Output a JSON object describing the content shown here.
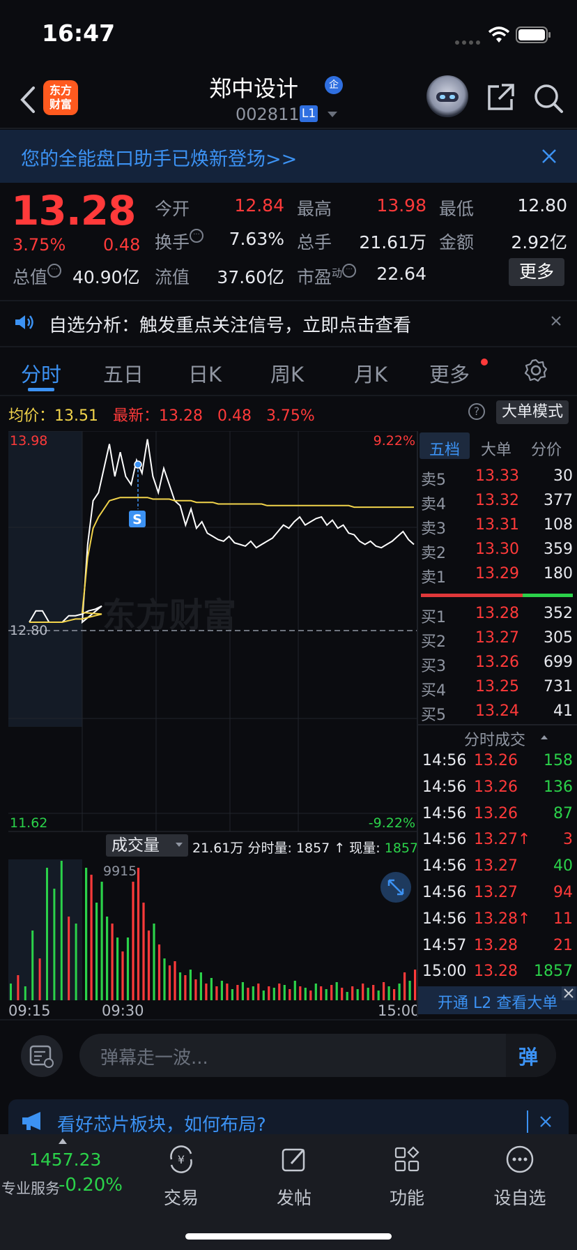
{
  "status_bar": {
    "time": "16:47"
  },
  "header": {
    "logo_text": "东方财富",
    "stock_name": "郑中设计",
    "badge": "企",
    "stock_code": "002811",
    "level": "L1"
  },
  "banner": {
    "text": "您的全能盘口助手已焕新登场>>"
  },
  "quote": {
    "price": "13.28",
    "change_pct": "3.75%",
    "change": "0.48",
    "market_cap_label": "总值",
    "market_cap": "40.90亿",
    "fields": [
      {
        "label": "今开",
        "value": "12.84",
        "color": "red"
      },
      {
        "label": "最高",
        "value": "13.98",
        "color": "red"
      },
      {
        "label": "最低",
        "value": "12.80",
        "color": "white"
      },
      {
        "label": "换手",
        "value": "7.63%",
        "color": "white"
      },
      {
        "label": "总手",
        "value": "21.61万",
        "color": "white"
      },
      {
        "label": "金额",
        "value": "2.92亿",
        "color": "white"
      },
      {
        "label": "流值",
        "value": "37.60亿",
        "color": "white"
      },
      {
        "label": "市盈",
        "sup": "动",
        "value": "22.64",
        "color": "white"
      }
    ],
    "more_button": "更多"
  },
  "notice": {
    "text": "自选分析：触发重点关注信号，立即点击查看"
  },
  "tabs": [
    "分时",
    "五日",
    "日K",
    "周K",
    "月K",
    "更多"
  ],
  "avg_row": {
    "avg_label": "均价：",
    "avg_value": "13.51",
    "latest_label": "最新：",
    "latest_price": "13.28",
    "latest_change": "0.48",
    "latest_pct": "3.75%",
    "big_order_mode": "大单模式"
  },
  "chart_data": {
    "type": "line",
    "y_high_label": "13.98",
    "y_mid_label": "12.80",
    "y_low_label": "11.62",
    "pct_high_label": "9.22%",
    "pct_low_label": "-9.22%",
    "ylim": [
      11.62,
      13.98
    ],
    "prev_close": 12.8,
    "x_labels": [
      "09:15",
      "09:30",
      "15:00"
    ],
    "watermark": "东方财富",
    "signal_marker": "S",
    "price_series": [
      12.8,
      12.87,
      12.87,
      12.8,
      12.8,
      12.8,
      12.84,
      12.84,
      12.85,
      12.87,
      12.88,
      12.9,
      12.8,
      13.28,
      13.55,
      13.6,
      13.75,
      13.9,
      13.7,
      13.85,
      13.7,
      13.65,
      13.8,
      13.72,
      13.93,
      13.7,
      13.6,
      13.75,
      13.65,
      13.55,
      13.52,
      13.4,
      13.5,
      13.38,
      13.42,
      13.35,
      13.33,
      13.31,
      13.3,
      13.33,
      13.29,
      13.28,
      13.27,
      13.3,
      13.26,
      13.28,
      13.3,
      13.32,
      13.36,
      13.4,
      13.38,
      13.42,
      13.45,
      13.4,
      13.42,
      13.44,
      13.45,
      13.4,
      13.43,
      13.38,
      13.4,
      13.35,
      13.34,
      13.3,
      13.28,
      13.3,
      13.27,
      13.26,
      13.28,
      13.3,
      13.33,
      13.36,
      13.31,
      13.28
    ],
    "avg_series": [
      12.8,
      12.8,
      12.8,
      12.8,
      12.8,
      12.8,
      12.81,
      12.82,
      12.82,
      12.83,
      12.84,
      12.85,
      12.86,
      13.2,
      13.38,
      13.45,
      13.5,
      13.55,
      13.56,
      13.57,
      13.57,
      13.57,
      13.57,
      13.57,
      13.57,
      13.56,
      13.56,
      13.56,
      13.56,
      13.55,
      13.55,
      13.55,
      13.55,
      13.54,
      13.54,
      13.54,
      13.54,
      13.53,
      13.53,
      13.53,
      13.53,
      13.53,
      13.53,
      13.53,
      13.53,
      13.53,
      13.52,
      13.52,
      13.52,
      13.52,
      13.52,
      13.52,
      13.52,
      13.52,
      13.52,
      13.52,
      13.52,
      13.52,
      13.52,
      13.52,
      13.52,
      13.52,
      13.51,
      13.51,
      13.51,
      13.51,
      13.51,
      13.51,
      13.51,
      13.51,
      13.51,
      13.51,
      13.51,
      13.51
    ],
    "volume_max_label": "9915",
    "volumes": [
      {
        "v": 0.12,
        "c": "g"
      },
      {
        "v": 0.18,
        "c": "r"
      },
      {
        "v": 0.1,
        "c": "g"
      },
      {
        "v": 0.5,
        "c": "g"
      },
      {
        "v": 0.3,
        "c": "r"
      },
      {
        "v": 0.95,
        "c": "g"
      },
      {
        "v": 0.8,
        "c": "g"
      },
      {
        "v": 1.0,
        "c": "g"
      },
      {
        "v": 0.6,
        "c": "r"
      },
      {
        "v": 0.55,
        "c": "g"
      },
      {
        "v": 0.95,
        "c": "g"
      },
      {
        "v": 0.9,
        "c": "r"
      },
      {
        "v": 0.7,
        "c": "g"
      },
      {
        "v": 0.85,
        "c": "g"
      },
      {
        "v": 0.6,
        "c": "g"
      },
      {
        "v": 0.55,
        "c": "r"
      },
      {
        "v": 0.45,
        "c": "g"
      },
      {
        "v": 0.35,
        "c": "r"
      },
      {
        "v": 0.45,
        "c": "g"
      },
      {
        "v": 0.85,
        "c": "r"
      },
      {
        "v": 0.95,
        "c": "r"
      },
      {
        "v": 0.7,
        "c": "r"
      },
      {
        "v": 0.5,
        "c": "r"
      },
      {
        "v": 0.55,
        "c": "g"
      },
      {
        "v": 0.4,
        "c": "r"
      },
      {
        "v": 0.3,
        "c": "g"
      },
      {
        "v": 0.25,
        "c": "r"
      },
      {
        "v": 0.28,
        "c": "r"
      },
      {
        "v": 0.2,
        "c": "g"
      },
      {
        "v": 0.18,
        "c": "r"
      },
      {
        "v": 0.22,
        "c": "g"
      },
      {
        "v": 0.15,
        "c": "r"
      },
      {
        "v": 0.2,
        "c": "g"
      },
      {
        "v": 0.12,
        "c": "r"
      },
      {
        "v": 0.16,
        "c": "g"
      },
      {
        "v": 0.1,
        "c": "r"
      },
      {
        "v": 0.14,
        "c": "g"
      },
      {
        "v": 0.12,
        "c": "r"
      },
      {
        "v": 0.08,
        "c": "g"
      },
      {
        "v": 0.11,
        "c": "r"
      },
      {
        "v": 0.13,
        "c": "g"
      },
      {
        "v": 0.09,
        "c": "r"
      },
      {
        "v": 0.1,
        "c": "g"
      },
      {
        "v": 0.12,
        "c": "r"
      },
      {
        "v": 0.07,
        "c": "g"
      },
      {
        "v": 0.1,
        "c": "r"
      },
      {
        "v": 0.09,
        "c": "g"
      },
      {
        "v": 0.12,
        "c": "r"
      },
      {
        "v": 0.11,
        "c": "g"
      },
      {
        "v": 0.08,
        "c": "r"
      },
      {
        "v": 0.14,
        "c": "g"
      },
      {
        "v": 0.1,
        "c": "r"
      },
      {
        "v": 0.09,
        "c": "g"
      },
      {
        "v": 0.07,
        "c": "r"
      },
      {
        "v": 0.12,
        "c": "g"
      },
      {
        "v": 0.1,
        "c": "r"
      },
      {
        "v": 0.08,
        "c": "g"
      },
      {
        "v": 0.11,
        "c": "r"
      },
      {
        "v": 0.13,
        "c": "g"
      },
      {
        "v": 0.09,
        "c": "r"
      },
      {
        "v": 0.06,
        "c": "g"
      },
      {
        "v": 0.1,
        "c": "r"
      },
      {
        "v": 0.08,
        "c": "g"
      },
      {
        "v": 0.12,
        "c": "r"
      },
      {
        "v": 0.09,
        "c": "g"
      },
      {
        "v": 0.11,
        "c": "r"
      },
      {
        "v": 0.07,
        "c": "g"
      },
      {
        "v": 0.13,
        "c": "r"
      },
      {
        "v": 0.1,
        "c": "g"
      },
      {
        "v": 0.08,
        "c": "r"
      },
      {
        "v": 0.12,
        "c": "g"
      },
      {
        "v": 0.2,
        "c": "r"
      },
      {
        "v": 0.14,
        "c": "g"
      },
      {
        "v": 0.22,
        "c": "r"
      }
    ]
  },
  "volume_toolbar": {
    "dropdown": "成交量",
    "total": "21.61万",
    "period_label": "分时量:",
    "period_value": "1857",
    "arrow": "↑",
    "current_label": "现量:",
    "current_value": "1857"
  },
  "side_panel": {
    "tabs": [
      "五档",
      "大单",
      "分价"
    ],
    "asks": [
      {
        "label": "卖5",
        "price": "13.33",
        "vol": "30"
      },
      {
        "label": "卖4",
        "price": "13.32",
        "vol": "377"
      },
      {
        "label": "卖3",
        "price": "13.31",
        "vol": "108"
      },
      {
        "label": "卖2",
        "price": "13.30",
        "vol": "359"
      },
      {
        "label": "卖1",
        "price": "13.29",
        "vol": "180"
      }
    ],
    "bids": [
      {
        "label": "买1",
        "price": "13.28",
        "vol": "352"
      },
      {
        "label": "买2",
        "price": "13.27",
        "vol": "305"
      },
      {
        "label": "买3",
        "price": "13.26",
        "vol": "699"
      },
      {
        "label": "买4",
        "price": "13.25",
        "vol": "731"
      },
      {
        "label": "买5",
        "price": "13.24",
        "vol": "41"
      }
    ],
    "ticks_title": "分时成交",
    "ticks": [
      {
        "time": "14:56",
        "price": "13.26",
        "vol": "158",
        "dir": "green"
      },
      {
        "time": "14:56",
        "price": "13.26",
        "vol": "136",
        "dir": "green"
      },
      {
        "time": "14:56",
        "price": "13.26",
        "vol": "87",
        "dir": "green"
      },
      {
        "time": "14:56",
        "price": "13.27↑",
        "vol": "3",
        "dir": "red"
      },
      {
        "time": "14:56",
        "price": "13.27",
        "vol": "40",
        "dir": "green"
      },
      {
        "time": "14:56",
        "price": "13.27",
        "vol": "94",
        "dir": "red"
      },
      {
        "time": "14:56",
        "price": "13.28↑",
        "vol": "11",
        "dir": "red"
      },
      {
        "time": "14:57",
        "price": "13.28",
        "vol": "21",
        "dir": "red"
      },
      {
        "time": "15:00",
        "price": "13.28",
        "vol": "1857",
        "dir": "green"
      }
    ],
    "l2_promo": "开通 L2 查看大单"
  },
  "danmaku": {
    "placeholder": "弹幕走一波...",
    "send": "弹"
  },
  "ad": {
    "text": "看好芯片板块，如何布局?"
  },
  "bottom_nav": {
    "index_value": "1457.23",
    "index_label": "专业服务",
    "index_pct": "-0.20%",
    "items": [
      "交易",
      "发帖",
      "功能",
      "设自选"
    ]
  },
  "colors": {
    "up": "#ff3a3a",
    "down": "#2bd24a",
    "accent": "#3c92f3",
    "avg_line": "#f2d44b"
  }
}
